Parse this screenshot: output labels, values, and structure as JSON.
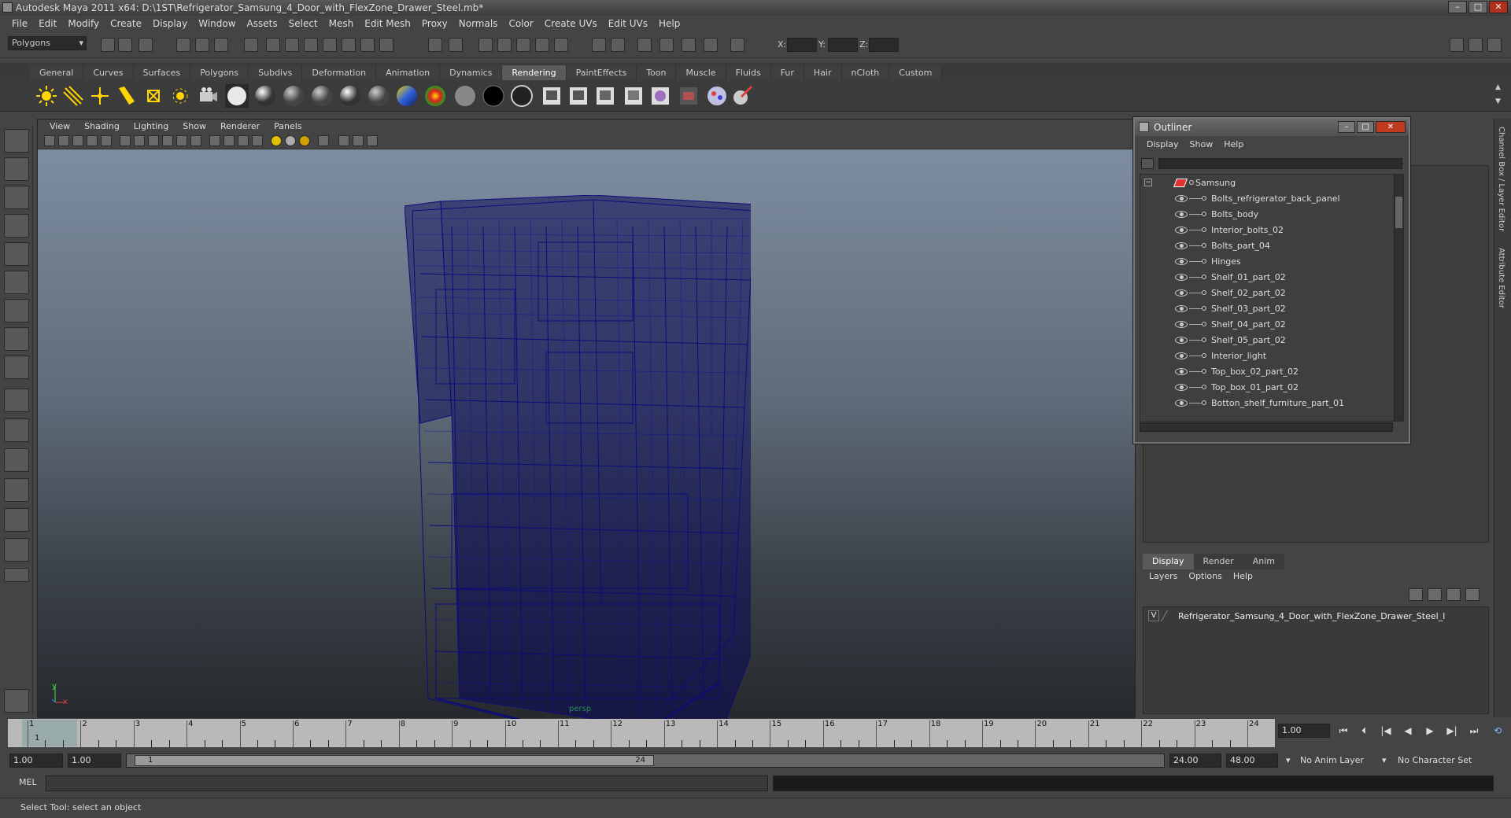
{
  "title": "Autodesk Maya 2011 x64: D:\\1ST\\Refrigerator_Samsung_4_Door_with_FlexZone_Drawer_Steel.mb*",
  "menu": [
    "File",
    "Edit",
    "Modify",
    "Create",
    "Display",
    "Window",
    "Assets",
    "Select",
    "Mesh",
    "Edit Mesh",
    "Proxy",
    "Normals",
    "Color",
    "Create UVs",
    "Edit UVs",
    "Help"
  ],
  "status": {
    "mode": "Polygons",
    "x_label": "X:",
    "y_label": "Y:",
    "z_label": "Z:"
  },
  "shelf_tabs": [
    "General",
    "Curves",
    "Surfaces",
    "Polygons",
    "Subdivs",
    "Deformation",
    "Animation",
    "Dynamics",
    "Rendering",
    "PaintEffects",
    "Toon",
    "Muscle",
    "Fluids",
    "Fur",
    "Hair",
    "nCloth",
    "Custom"
  ],
  "active_shelf": "Rendering",
  "viewport": {
    "menu": [
      "View",
      "Shading",
      "Lighting",
      "Show",
      "Renderer",
      "Panels"
    ],
    "camera": "persp",
    "axis_x": "x",
    "axis_y": "y"
  },
  "outliner": {
    "title": "Outliner",
    "menu": [
      "Display",
      "Show",
      "Help"
    ],
    "root": "Samsung",
    "items": [
      "Bolts_refrigerator_back_panel",
      "Bolts_body",
      "Interior_bolts_02",
      "Bolts_part_04",
      "Hinges",
      "Shelf_01_part_02",
      "Shelf_02_part_02",
      "Shelf_03_part_02",
      "Shelf_04_part_02",
      "Shelf_05_part_02",
      "Interior_light",
      "Top_box_02_part_02",
      "Top_box_01_part_02",
      "Botton_shelf_furniture_part_01"
    ]
  },
  "side_tabs": [
    "Channel Box / Layer Editor",
    "Attribute Editor"
  ],
  "layers": {
    "tabs": [
      "Display",
      "Render",
      "Anim"
    ],
    "active_tab": "Display",
    "menu": [
      "Layers",
      "Options",
      "Help"
    ],
    "visible_flag": "V",
    "layer_name": "Refrigerator_Samsung_4_Door_with_FlexZone_Drawer_Steel_l"
  },
  "timeline": {
    "ticks": [
      "1",
      "2",
      "3",
      "4",
      "5",
      "6",
      "7",
      "8",
      "9",
      "10",
      "11",
      "12",
      "13",
      "14",
      "15",
      "16",
      "17",
      "18",
      "19",
      "20",
      "21",
      "22",
      "23",
      "24"
    ],
    "current_frame": "1",
    "current_time_field": "1.00"
  },
  "range": {
    "start": "1.00",
    "playback_start": "1.00",
    "slider_start": "1",
    "slider_end": "24",
    "playback_end": "24.00",
    "end": "48.00",
    "anim_layer": "No Anim Layer",
    "char_set": "No Character Set"
  },
  "mel": {
    "label": "MEL"
  },
  "help_line": "Select Tool: select an object",
  "colors": {
    "wireframe": "#0c0c7a",
    "active_tab": "#5a5a5a"
  }
}
